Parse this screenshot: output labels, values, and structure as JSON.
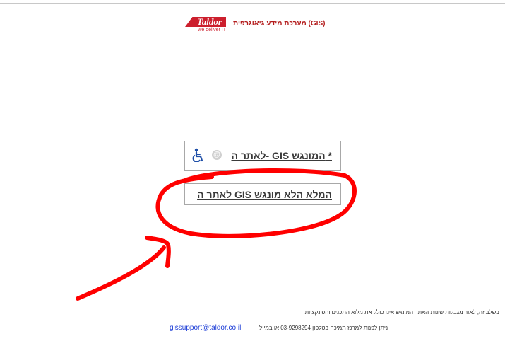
{
  "header": {
    "logo_brand": "Taldor",
    "logo_slogan": "we deliver IT",
    "title": "מערכת מידע גיאוגרפית (GIS)"
  },
  "buttons": {
    "accessible_site_label": "לאתר ה- GIS המונגש *",
    "full_site_label": "לאתר ה GIS המלא הלא מונגש",
    "at_icon_glyph": "@"
  },
  "footer": {
    "note": "בשלב זה, לאור מגבלות שונות האתר המונגש אינו כולל את מלוא התכנים והפונקציות.",
    "contact_text": "ניתן לפנות למרכז תמיכה בטלפון 03-9298294 או במייל",
    "contact_email": "gissupport@taldor.co.il"
  },
  "colors": {
    "brand_red": "#cc1f2d",
    "title_red": "#b31b1b",
    "annotation_red": "#ff0000",
    "link_blue": "#1a3bd6"
  }
}
